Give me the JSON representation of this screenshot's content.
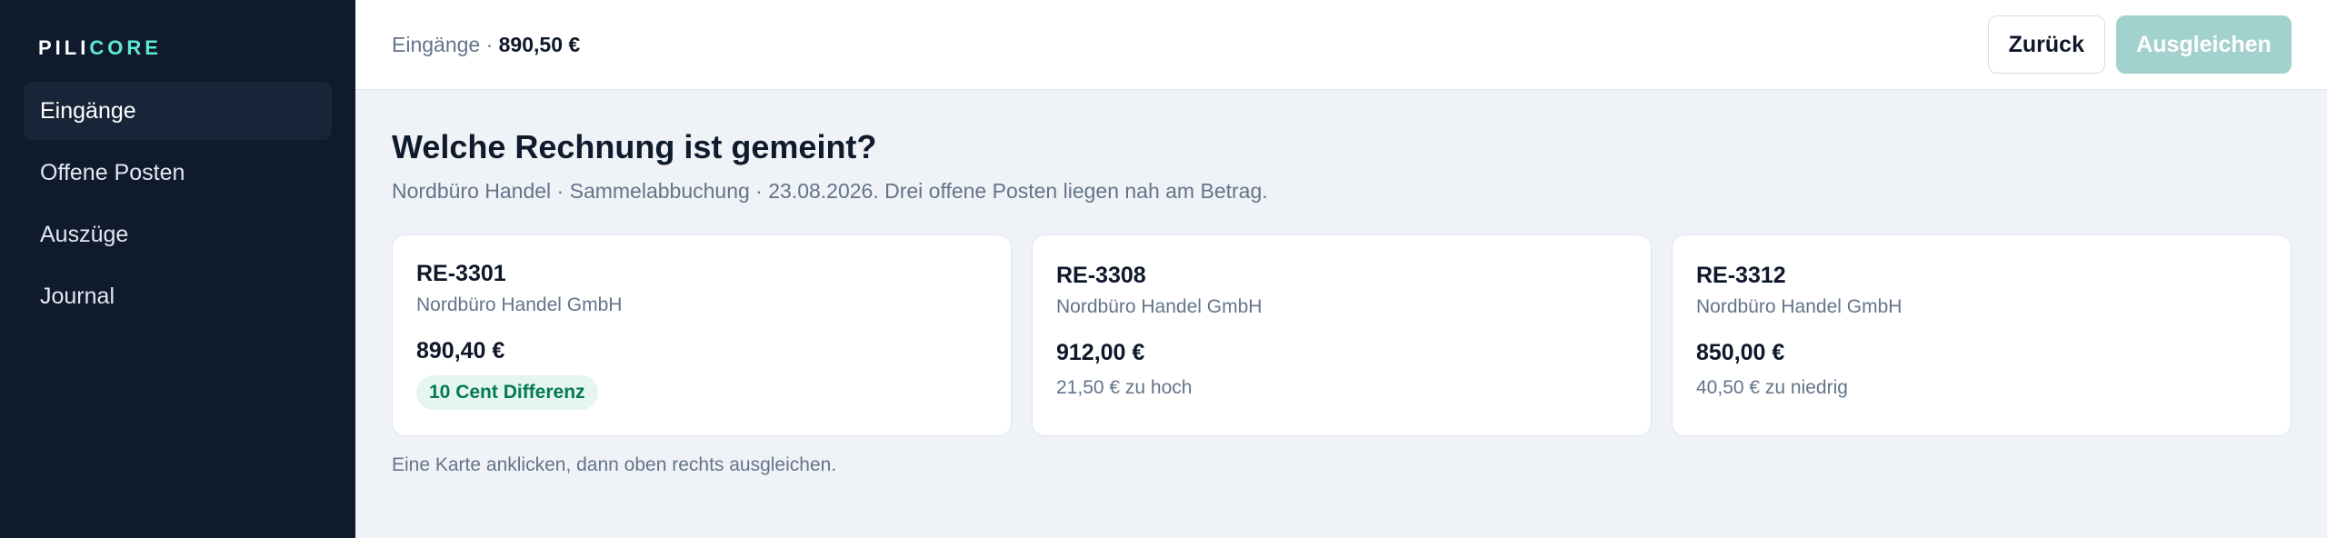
{
  "brand": {
    "part1": "PILI",
    "part2": "CORE"
  },
  "sidebar": {
    "items": [
      {
        "label": "Eingänge",
        "active": true
      },
      {
        "label": "Offene Posten",
        "active": false
      },
      {
        "label": "Auszüge",
        "active": false
      },
      {
        "label": "Journal",
        "active": false
      }
    ]
  },
  "header": {
    "crumb_label": "Eingänge · ",
    "crumb_amount": "890,50 €",
    "back_label": "Zurück",
    "apply_label": "Ausgleichen"
  },
  "main": {
    "title": "Welche Rechnung ist gemeint?",
    "subtitle": "Nordbüro Handel · Sammelabbuchung · 23.08.2026. Drei offene Posten liegen nah am Betrag.",
    "hint": "Eine Karte anklicken, dann oben rechts ausgleichen."
  },
  "cards": [
    {
      "id": "RE-3301",
      "company": "Nordbüro Handel GmbH",
      "amount": "890,40 €",
      "note": "10 Cent Differenz"
    },
    {
      "id": "RE-3308",
      "company": "Nordbüro Handel GmbH",
      "amount": "912,00 €",
      "note": "21,50 € zu hoch"
    },
    {
      "id": "RE-3312",
      "company": "Nordbüro Handel GmbH",
      "amount": "850,00 €",
      "note": "40,50 € zu niedrig"
    }
  ],
  "colors": {
    "sidebar_bg": "#0f1a2d",
    "brand_accent": "#5eead4",
    "primary_disabled": "#a3d1cd",
    "badge_bg": "#e4f6ee",
    "badge_text": "#047857"
  }
}
